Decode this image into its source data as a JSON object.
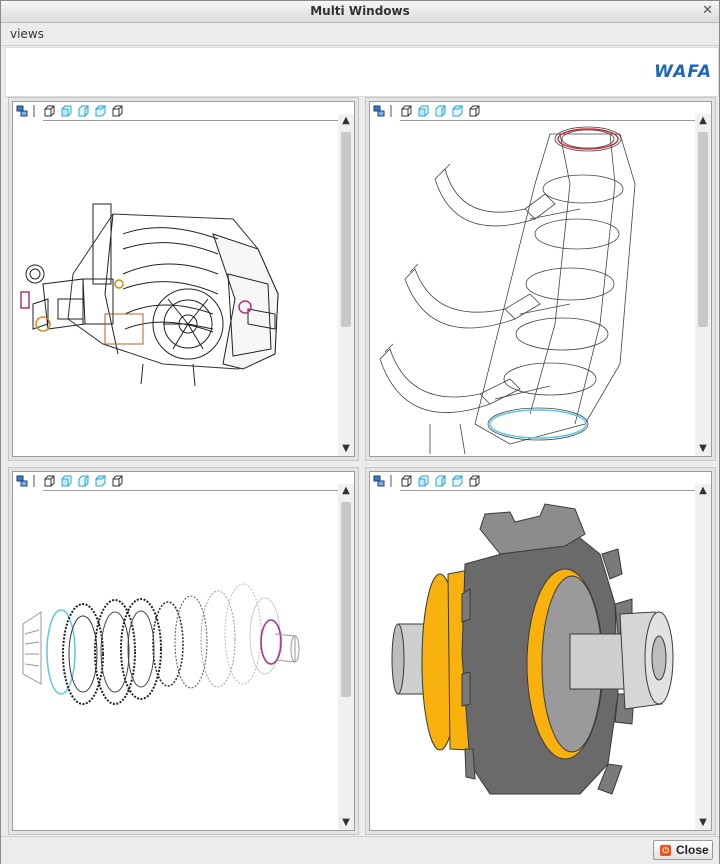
{
  "window": {
    "title": "Multi Windows"
  },
  "menu": {
    "views": "views"
  },
  "banner": {
    "logo": "WAFA"
  },
  "toolbar_icons": [
    "model-tree-icon",
    "divider",
    "view-cube-icon",
    "view-front-icon",
    "view-side-icon",
    "view-top-icon",
    "view-iso-icon"
  ],
  "panels": [
    {
      "id": "top-left",
      "content": "transmission-housing-wireframe"
    },
    {
      "id": "top-right",
      "content": "shift-forks-shaft-wireframe"
    },
    {
      "id": "bottom-left",
      "content": "gear-set-wireframe"
    },
    {
      "id": "bottom-right",
      "content": "gear-shaded"
    }
  ],
  "colors": {
    "accent": "#1d66b8",
    "highlight_orange": "#f9b20d",
    "gear_grey": "#a8a8a8",
    "wire_cyan": "#5bc8e6",
    "wire_magenta": "#b0308a"
  },
  "footer": {
    "close_label": "Close"
  }
}
